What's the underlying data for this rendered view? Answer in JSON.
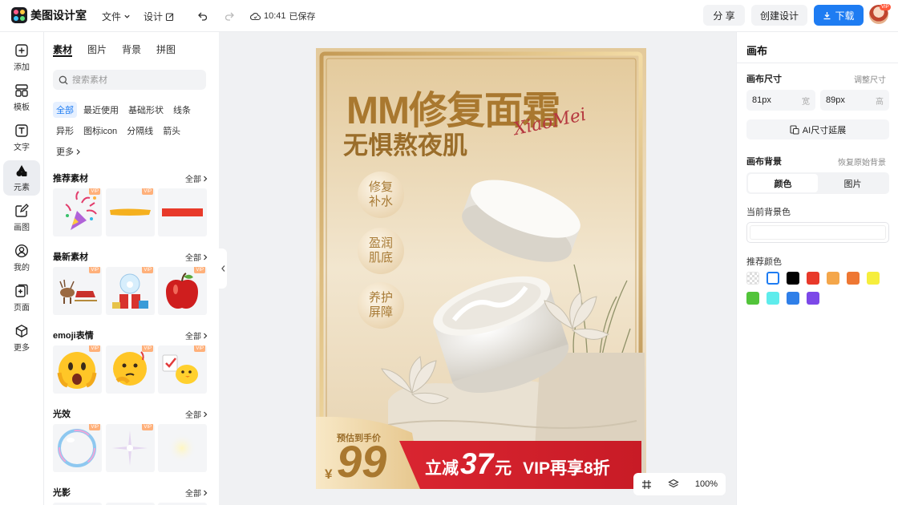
{
  "app": {
    "name": "美图设计室"
  },
  "topbar": {
    "menu_file": "文件",
    "menu_design": "设计",
    "save_time": "10:41",
    "save_status": "已保存",
    "share": "分 享",
    "create": "创建设计",
    "download": "下载",
    "avatar_badge": "VIP"
  },
  "rail": {
    "items": [
      {
        "label": "添加",
        "icon": "plus-square-icon"
      },
      {
        "label": "模板",
        "icon": "template-icon"
      },
      {
        "label": "文字",
        "icon": "text-icon"
      },
      {
        "label": "元素",
        "icon": "shapes-icon"
      },
      {
        "label": "画图",
        "icon": "draw-icon"
      },
      {
        "label": "我的",
        "icon": "user-icon"
      },
      {
        "label": "页面",
        "icon": "page-add-icon"
      },
      {
        "label": "更多",
        "icon": "cube-icon"
      }
    ],
    "active": "元素"
  },
  "left_panel": {
    "tabs": [
      "素材",
      "图片",
      "背景",
      "拼图"
    ],
    "active_tab": "素材",
    "search_placeholder": "搜索素材",
    "chips_row1": [
      "全部",
      "最近使用",
      "基础形状",
      "线条"
    ],
    "chips_row2": [
      "异形",
      "图标icon",
      "分隔线",
      "箭头"
    ],
    "chip_more": "更多",
    "all_label": "全部",
    "vip": "VIP",
    "sections": [
      {
        "title": "推荐素材",
        "items": [
          "party-popper",
          "yellow-brush-stroke",
          "red-bar"
        ]
      },
      {
        "title": "最新素材",
        "items": [
          "reindeer-sleigh",
          "snow-globe-gift",
          "red-apple"
        ]
      },
      {
        "title": "emoji表情",
        "items": [
          "shocked-emoji",
          "thinking-emoji",
          "chick-emoji"
        ]
      },
      {
        "title": "光效",
        "items": [
          "bubble-ring",
          "sparkle-star",
          "soft-glow"
        ]
      },
      {
        "title": "光影",
        "items": []
      }
    ]
  },
  "poster": {
    "title": "MM修复面霜",
    "subtitle": "无惧熬夜肌",
    "signature": "XiaoMei",
    "badges": [
      [
        "修复",
        "补水"
      ],
      [
        "盈润",
        "肌底"
      ],
      [
        "养护",
        "屏障"
      ]
    ],
    "price_label": "预估到手价",
    "currency": "¥",
    "price": "99",
    "discount_prefix": "立减",
    "discount_amount": "37",
    "discount_unit": "元",
    "vip_offer": "VIP再享8折"
  },
  "bottom_tools": {
    "zoom": "100%"
  },
  "right_panel": {
    "title": "画布",
    "size_label": "画布尺寸",
    "adjust_size": "调整尺寸",
    "width_value": "81px",
    "width_unit": "宽",
    "height_value": "89px",
    "height_unit": "高",
    "ai_extend": "AI尺寸延展",
    "bg_label": "画布背景",
    "restore_bg": "恢复原始背景",
    "seg_color": "颜色",
    "seg_image": "图片",
    "current_bg": "当前背景色",
    "recommended": "推荐颜色",
    "swatches": [
      "transparent",
      "#ffffff",
      "#000000",
      "#e8392a",
      "#f4a64a",
      "#ee7733",
      "#f6ee3c",
      "#52c43a",
      "#5eecec",
      "#2f7fe8",
      "#7c48e8"
    ]
  }
}
